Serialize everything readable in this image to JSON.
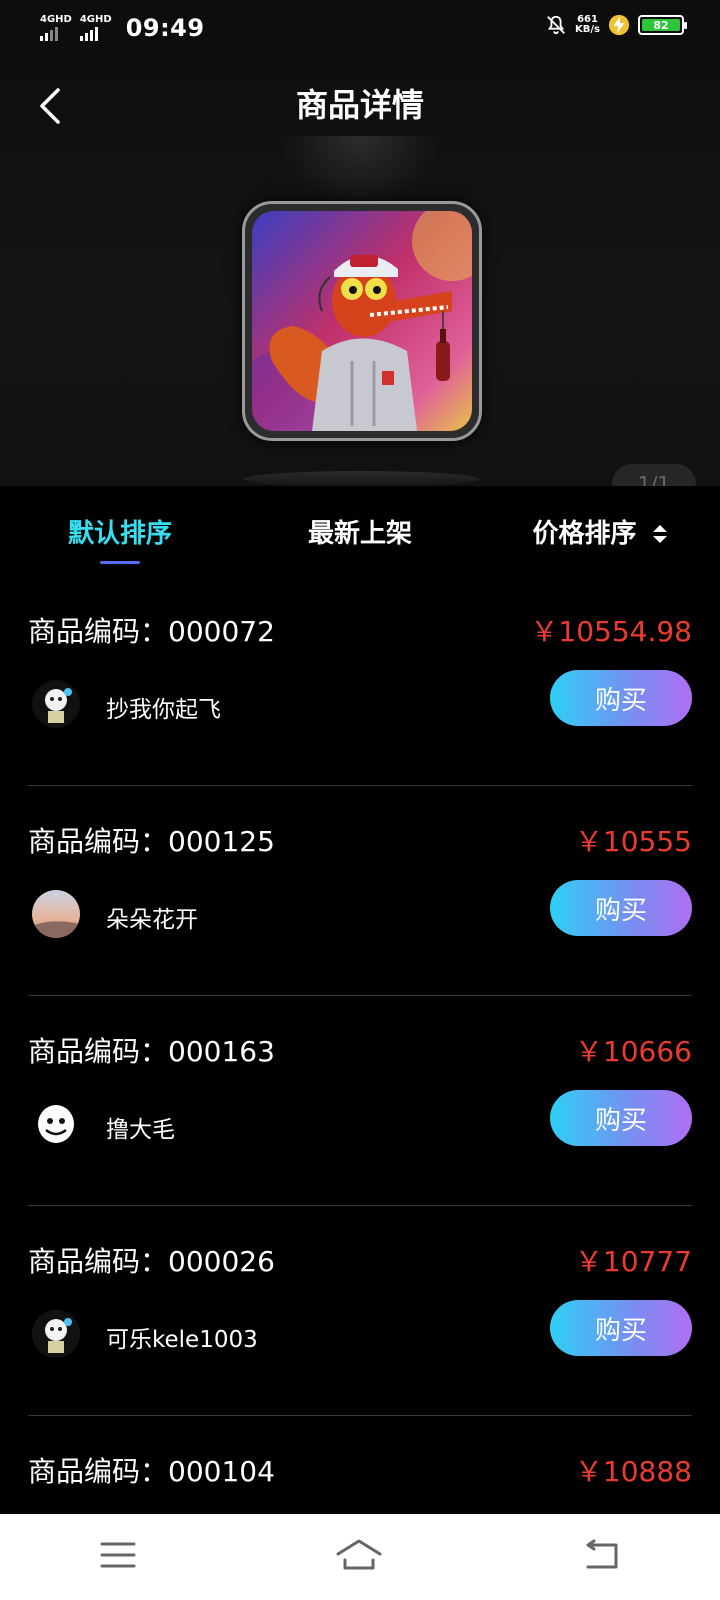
{
  "status_bar": {
    "signal_1": "4GHD",
    "signal_2": "4GHD",
    "time": "09:49",
    "net_speed_value": "661",
    "net_speed_unit": "KB/s",
    "battery_level": "82"
  },
  "header": {
    "title": "商品详情"
  },
  "hero": {
    "pager": "1/1"
  },
  "tabs": [
    {
      "label": "默认排序",
      "active": true
    },
    {
      "label": "最新上架",
      "active": false
    },
    {
      "label": "价格排序",
      "active": false
    }
  ],
  "items": [
    {
      "code": "商品编码：000072",
      "price": "￥10554.98",
      "seller": "抄我你起飞",
      "buy_label": "购买"
    },
    {
      "code": "商品编码：000125",
      "price": "￥10555",
      "seller": "朵朵花开",
      "buy_label": "购买"
    },
    {
      "code": "商品编码：000163",
      "price": "￥10666",
      "seller": "撸大毛",
      "buy_label": "购买"
    },
    {
      "code": "商品编码：000026",
      "price": "￥10777",
      "seller": "可乐kele1003",
      "buy_label": "购买"
    },
    {
      "code": "商品编码：000104",
      "price": "￥10888"
    }
  ],
  "colors": {
    "active_tab": "#36e0f0",
    "price": "#ea3b2e",
    "button_gradient_start": "#2ed0f4",
    "button_gradient_end": "#b06ef2"
  }
}
